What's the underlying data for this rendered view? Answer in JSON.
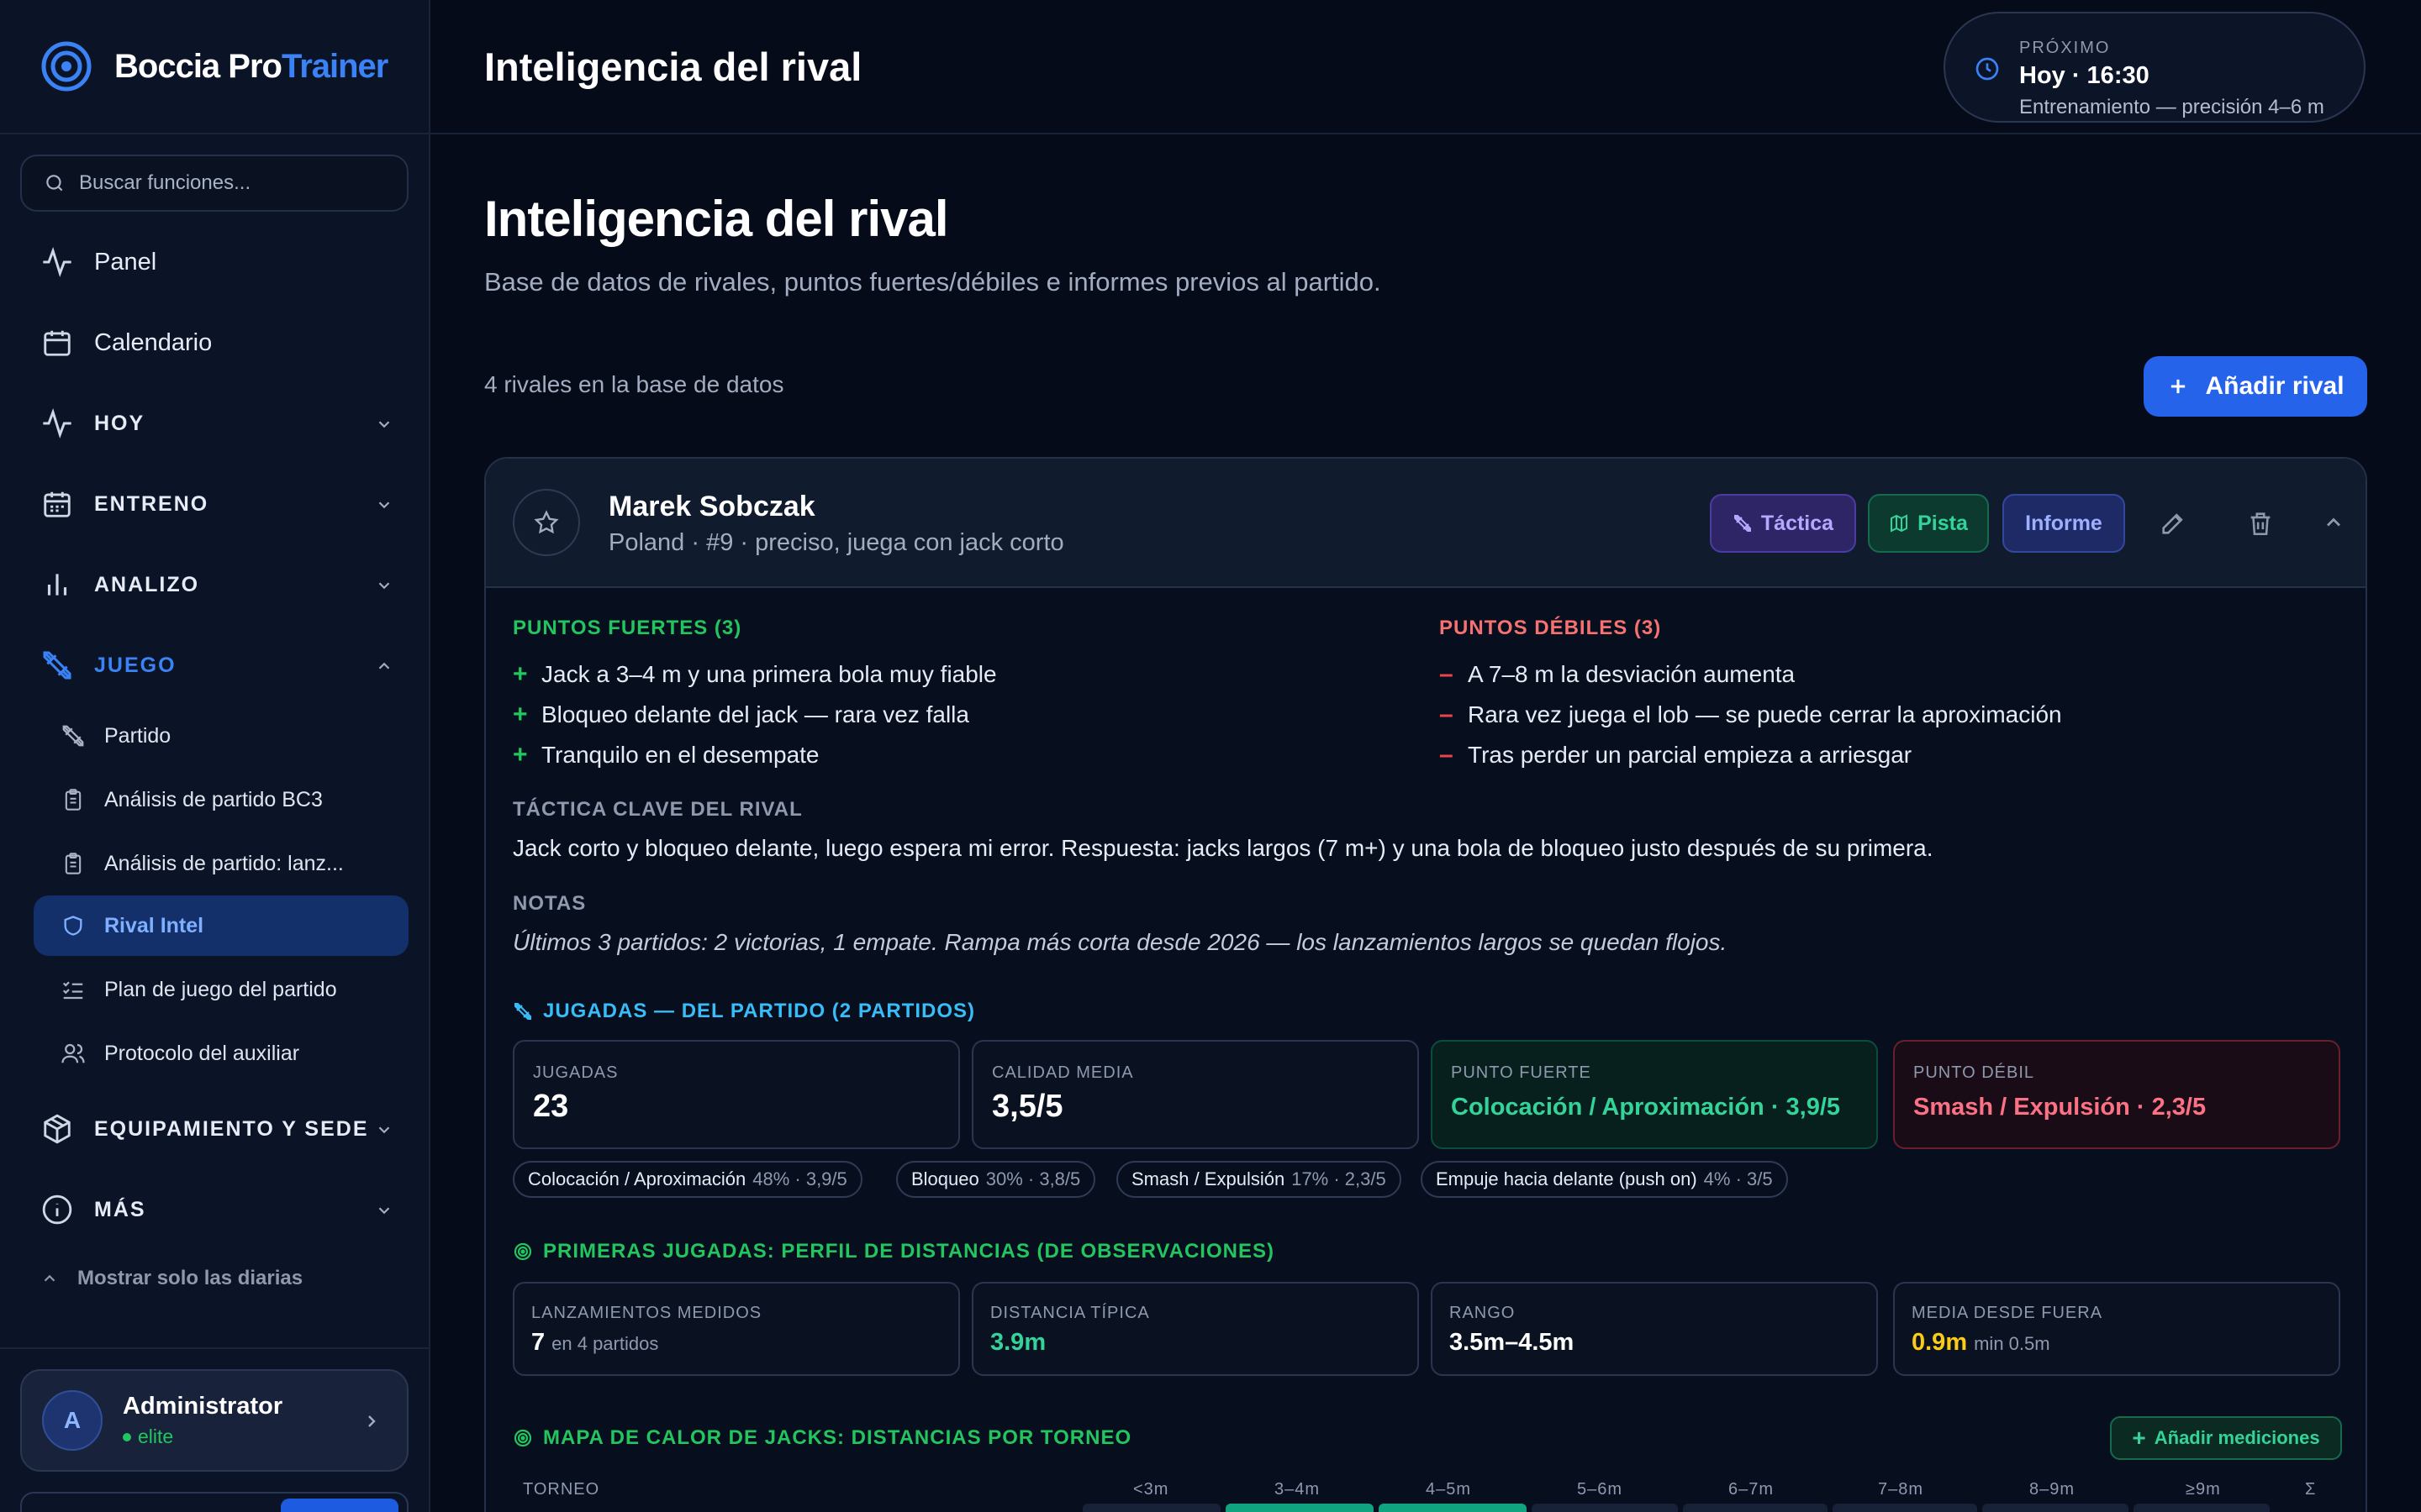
{
  "app": {
    "name_main": "Boccia Pro",
    "name_accent": "Trainer",
    "logo_icon": "target-icon",
    "colors": {
      "accent": "#3b82f6",
      "good": "#34d399",
      "bad": "#fb7185",
      "warn": "#facc15",
      "primary_button": "#2563eb"
    }
  },
  "sidebar": {
    "search_placeholder": "Buscar funciones...",
    "items": [
      {
        "label": "Panel",
        "icon": "activity-icon"
      },
      {
        "label": "Calendario",
        "icon": "calendar-icon"
      },
      {
        "label": "HOY",
        "icon": "pulse-icon",
        "expanded": false
      },
      {
        "label": "ENTRENO",
        "icon": "calendar-grid-icon",
        "expanded": false
      },
      {
        "label": "ANALIZO",
        "icon": "bar-chart-icon",
        "expanded": false
      },
      {
        "label": "JUEGO",
        "icon": "swords-icon",
        "expanded": true
      },
      {
        "label": "EQUIPAMIENTO Y SEDE",
        "icon": "box-icon",
        "expanded": false
      },
      {
        "label": "MÁS",
        "icon": "info-icon",
        "expanded": false
      }
    ],
    "sub_items": [
      {
        "label": "Partido",
        "icon": "swords-icon"
      },
      {
        "label": "Análisis de partido BC3",
        "icon": "clipboard-icon"
      },
      {
        "label": "Análisis de partido: lanz...",
        "icon": "clipboard-icon"
      },
      {
        "label": "Rival Intel",
        "icon": "shield-icon",
        "active": true
      },
      {
        "label": "Plan de juego del partido",
        "icon": "list-check-icon"
      },
      {
        "label": "Protocolo del auxiliar",
        "icon": "users-icon"
      }
    ],
    "show_daily": "Mostrar solo las diarias",
    "user": {
      "initial": "A",
      "name": "Administrator",
      "role": "elite"
    }
  },
  "topbar": {
    "title": "Inteligencia del rival",
    "next": {
      "kicker": "PRÓXIMO",
      "time": "Hoy · 16:30",
      "desc": "Entrenamiento — precisión 4–6 m"
    }
  },
  "page": {
    "title": "Inteligencia del rival",
    "subtitle": "Base de datos de rivales, puntos fuertes/débiles e informes previos al partido.",
    "count": "4 rivales en la base de datos",
    "add_button": "Añadir rival"
  },
  "rival": {
    "name": "Marek Sobczak",
    "meta": "Poland · #9 · preciso, juega con jack corto",
    "tags": {
      "tactica": "Táctica",
      "pista": "Pista",
      "informe": "Informe"
    },
    "strengths_label": "PUNTOS FUERTES (3)",
    "strengths": [
      "Jack a 3–4 m y una primera bola muy fiable",
      "Bloqueo delante del jack — rara vez falla",
      "Tranquilo en el desempate"
    ],
    "weaknesses_label": "PUNTOS DÉBILES (3)",
    "weaknesses": [
      "A 7–8 m la desviación aumenta",
      "Rara vez juega el lob — se puede cerrar la aproximación",
      "Tras perder un parcial empieza a arriesgar"
    ],
    "tactic_label": "TÁCTICA CLAVE DEL RIVAL",
    "tactic": "Jack corto y bloqueo delante, luego espera mi error. Respuesta: jacks largos (7 m+) y una bola de bloqueo justo después de su primera.",
    "notes_label": "NOTAS",
    "notes": "Últimos 3 partidos: 2 victorias, 1 empate. Rampa más corta desde 2026 — los lanzamientos largos se quedan flojos.",
    "plays": {
      "label": "JUGADAS — DEL PARTIDO (2 PARTIDOS)",
      "stats": [
        {
          "key": "JUGADAS",
          "value": "23"
        },
        {
          "key": "CALIDAD MEDIA",
          "value": "3,5/5"
        },
        {
          "key": "PUNTO FUERTE",
          "value": "Colocación / Aproximación · 3,9/5"
        },
        {
          "key": "PUNTO DÉBIL",
          "value": "Smash / Expulsión · 2,3/5"
        }
      ],
      "chips": [
        {
          "name": "Colocación / Aproximación",
          "detail": "48% · 3,9/5"
        },
        {
          "name": "Bloqueo",
          "detail": "30% · 3,8/5"
        },
        {
          "name": "Smash / Expulsión",
          "detail": "17% · 2,3/5"
        },
        {
          "name": "Empuje hacia delante (push on)",
          "detail": "4% · 3/5"
        }
      ]
    },
    "distances": {
      "label": "PRIMERAS JUGADAS: PERFIL DE DISTANCIAS (DE OBSERVACIONES)",
      "stats": [
        {
          "key": "LANZAMIENTOS MEDIDOS",
          "value": "7",
          "unit": "en 4 partidos"
        },
        {
          "key": "DISTANCIA TÍPICA",
          "value": "3.9m"
        },
        {
          "key": "RANGO",
          "value": "3.5m–4.5m"
        },
        {
          "key": "MEDIA DESDE FUERA",
          "value": "0.9m",
          "unit": "min 0.5m"
        }
      ]
    },
    "heatmap": {
      "label": "MAPA DE CALOR DE JACKS: DISTANCIAS POR TORNEO",
      "button": "Añadir mediciones",
      "col_tournament": "TORNEO",
      "columns": [
        "<3m",
        "3–4m",
        "4–5m",
        "5–6m",
        "6–7m",
        "7–8m",
        "8–9m",
        "≥9m",
        "Σ"
      ],
      "hot_columns": [
        1,
        2
      ]
    }
  }
}
